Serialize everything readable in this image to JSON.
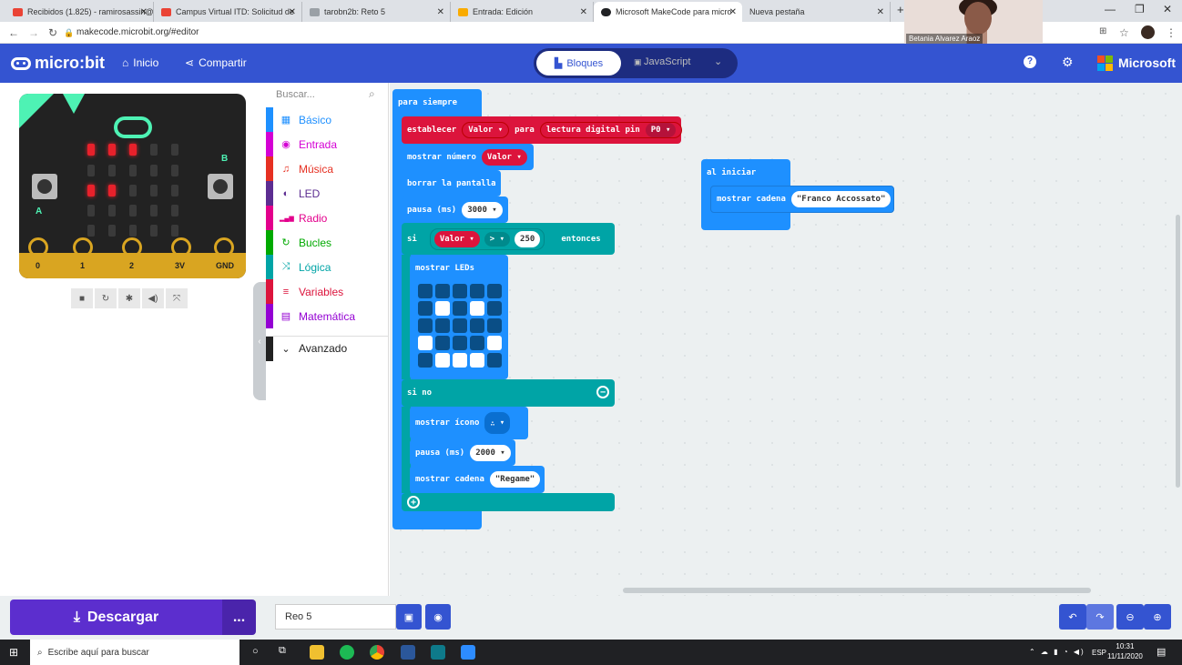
{
  "browser": {
    "tabs": [
      {
        "title": "Recibidos (1.825) - ramirosassin@",
        "color": "#ea4335"
      },
      {
        "title": "Campus Virtual ITD: Solicitud de",
        "color": "#ea4335"
      },
      {
        "title": "tarobn2b: Reto 5",
        "color": "#9aa0a6"
      },
      {
        "title": "Entrada: Edición",
        "color": "#f9ab00"
      },
      {
        "title": "Microsoft MakeCode para micro",
        "color": "#202124"
      },
      {
        "title": "Nueva pestaña",
        "color": "#dee1e6"
      }
    ],
    "new_tab": "+",
    "url": "makecode.microbit.org/#editor"
  },
  "webcam": {
    "name": "Betania Alvarez Araoz"
  },
  "header": {
    "brand": "micro:bit",
    "home": "Inicio",
    "share": "Compartir",
    "blocks": "Bloques",
    "javascript": "JavaScript",
    "microsoft": "Microsoft"
  },
  "toolbox": {
    "search_placeholder": "Buscar...",
    "categories": [
      {
        "label": "Básico",
        "color": "#1e90ff",
        "icon": "▦"
      },
      {
        "label": "Entrada",
        "color": "#d400d4",
        "icon": "◉"
      },
      {
        "label": "Música",
        "color": "#e63022",
        "icon": "♫"
      },
      {
        "label": "LED",
        "color": "#5c2d91",
        "icon": "◐"
      },
      {
        "label": "Radio",
        "color": "#e3008c",
        "icon": "▂▄▆"
      },
      {
        "label": "Bucles",
        "color": "#00aa00",
        "icon": "↻"
      },
      {
        "label": "Lógica",
        "color": "#00a4a6",
        "icon": "⤨"
      },
      {
        "label": "Variables",
        "color": "#dc143c",
        "icon": "≡"
      },
      {
        "label": "Matemática",
        "color": "#9400d3",
        "icon": "▤"
      },
      {
        "label": "Avanzado",
        "color": "#212121",
        "icon": "⌄"
      }
    ]
  },
  "simulator": {
    "pins": [
      "0",
      "1",
      "2",
      "3V",
      "GND"
    ],
    "button_a": "A",
    "button_b": "B"
  },
  "blocks": {
    "forever": "para siempre",
    "set": "establecer",
    "var1": "Valor",
    "for": "para",
    "digital_read": "lectura digital pin",
    "pin": "P0",
    "show_number": "mostrar número",
    "var2": "Valor",
    "clear": "borrar la pantalla",
    "pause1_label": "pausa (ms)",
    "pause1_value": "3000",
    "if": "si",
    "cond_var": "Valor",
    "op": ">",
    "cond_value": "250",
    "then": "entonces",
    "show_leds": "mostrar LEDs",
    "led_grid": [
      [
        0,
        0,
        0,
        0,
        0
      ],
      [
        0,
        1,
        0,
        1,
        0
      ],
      [
        0,
        0,
        0,
        0,
        0
      ],
      [
        1,
        0,
        0,
        0,
        1
      ],
      [
        0,
        1,
        1,
        1,
        0
      ]
    ],
    "else": "si no",
    "show_icon": "mostrar ícono",
    "pause2_label": "pausa (ms)",
    "pause2_value": "2000",
    "show_string": "mostrar cadena",
    "string_value": "\"Regame\"",
    "on_start": "al iniciar",
    "show_string2": "mostrar cadena",
    "string2_value": "\"Franco Accossato\""
  },
  "footer": {
    "download": "Descargar",
    "more": "...",
    "project_name": "Reo 5"
  },
  "taskbar": {
    "search": "Escribe aquí para buscar",
    "lang": "ESP",
    "time": "10:31",
    "date": "11/11/2020"
  }
}
